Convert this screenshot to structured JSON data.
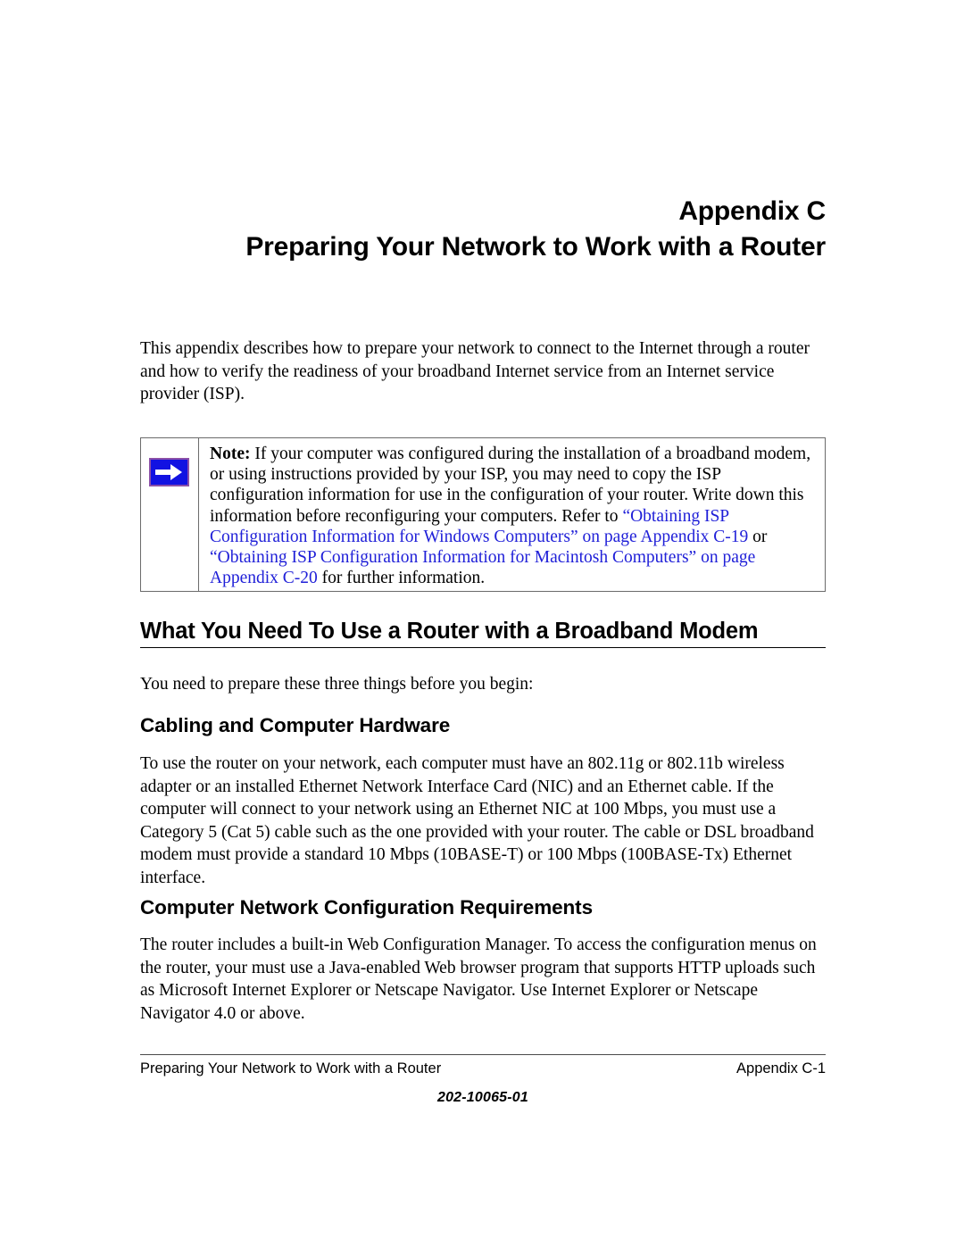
{
  "title": {
    "line1": "Appendix C",
    "line2": "Preparing Your Network to Work with a Router"
  },
  "intro": {
    "text": "This appendix describes how to prepare your network to connect to the Internet through a router and how to verify the readiness of your broadband Internet service from an Internet service provider (ISP)."
  },
  "note": {
    "icon_name": "note-arrow-icon",
    "icon_bg_color": "#1212e2",
    "icon_border_color": "#8b4fa8",
    "icon_arrow_color": "#ffffff",
    "link_color": "#2020d8",
    "label": "Note:",
    "text_part1": " If your computer was configured during the installation of a broadband modem, or using instructions provided by your ISP, you may need to copy the ISP configuration information for use in the configuration of your router. Write down this information before reconfiguring your computers. Refer to ",
    "link1": "“Obtaining ISP Configuration Information for Windows Computers” on page Appendix C-19",
    "text_part2": " or ",
    "link2": "“Obtaining ISP Configuration Information for Macintosh Computers” on page Appendix C-20",
    "text_part3": " for further information."
  },
  "section": {
    "heading": "What You Need To Use a Router with a Broadband Modem",
    "lead_paragraph": "You need to prepare these three things before you begin:"
  },
  "subsections": [
    {
      "heading": "Cabling and Computer Hardware",
      "paragraph": "To use the router on your network, each computer must have an 802.11g or 802.11b wireless adapter or an installed Ethernet Network Interface Card (NIC) and an Ethernet cable. If the computer will connect to your network using an Ethernet NIC at 100 Mbps, you must use a Category 5 (Cat 5) cable such as the one provided with your router. The cable or DSL broadband modem must provide a standard 10 Mbps (10BASE-T) or 100 Mbps (100BASE-Tx) Ethernet interface."
    },
    {
      "heading": "Computer Network Configuration Requirements",
      "paragraph": "The router includes a built-in Web Configuration Manager. To access the configuration menus on the router, your must use a Java-enabled Web browser program that supports HTTP uploads such as Microsoft Internet Explorer or Netscape Navigator. Use Internet Explorer or Netscape Navigator 4.0 or above."
    }
  ],
  "footer": {
    "left": "Preparing Your Network to Work with a Router",
    "right": "Appendix C-1",
    "doc_number": "202-10065-01"
  }
}
